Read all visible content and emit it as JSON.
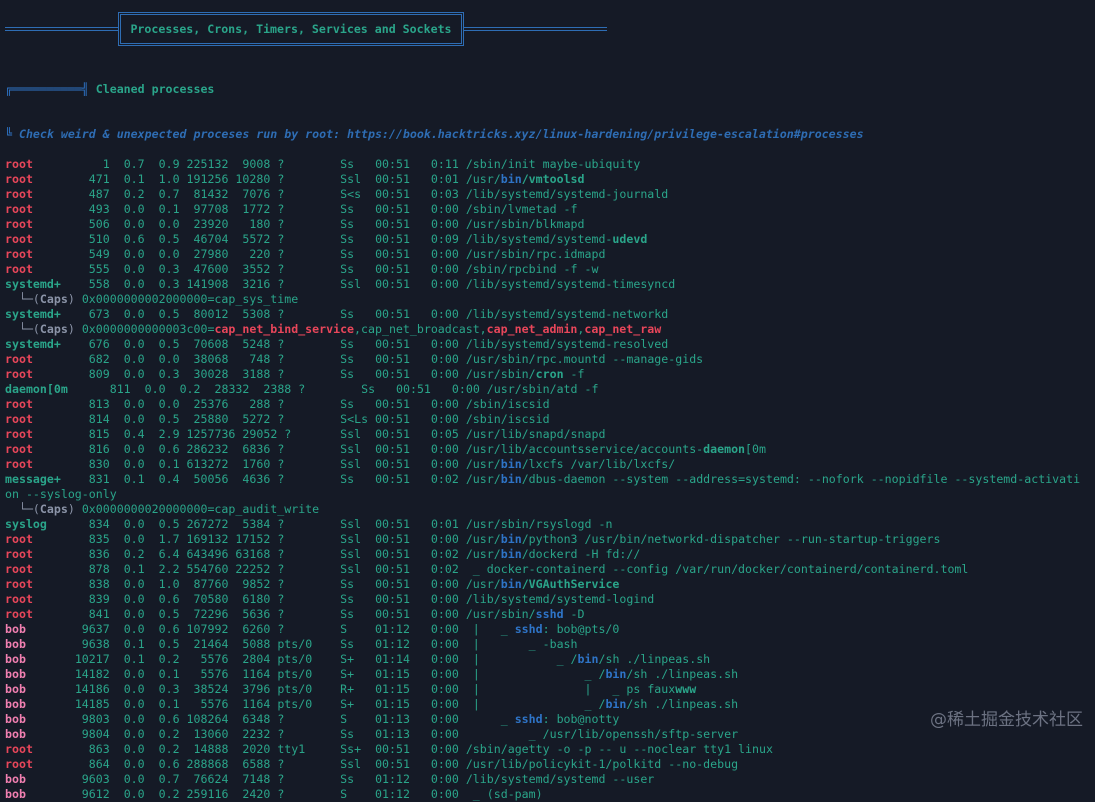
{
  "header": {
    "title": "Processes, Crons, Timers, Services and Sockets"
  },
  "section": {
    "title": "Cleaned processes",
    "hint": "Check weird & unexpected proceses run by root: https://book.hacktricks.xyz/linux-hardening/privilege-escalation#processes"
  },
  "caps_label": "Caps",
  "watermark": "@稀土掘金技术社区",
  "theme": {
    "background": "#151a26",
    "teal": "#2aa58a",
    "red": "#e8465a",
    "pink": "#f07fb0",
    "blue": "#2e74c7",
    "gray": "#8b94a8"
  },
  "lines": [
    {
      "type": "proc",
      "user": "root",
      "pid": "1",
      "cpu": "0.7",
      "mem": "0.9",
      "vsz": "225132",
      "rss": "9008",
      "tty": "?",
      "stat": "Ss",
      "start": "00:51",
      "time": "0:11",
      "cmd": [
        [
          "/sbin/init maybe-ubiquity",
          ""
        ]
      ]
    },
    {
      "type": "proc",
      "user": "root",
      "pid": "471",
      "cpu": "0.1",
      "mem": "1.0",
      "vsz": "191256",
      "rss": "10280",
      "tty": "?",
      "stat": "Ssl",
      "start": "00:51",
      "time": "0:01",
      "cmd": [
        [
          "/usr/",
          ""
        ],
        [
          "bin",
          "bb"
        ],
        [
          "/vmtoolsd",
          "g"
        ]
      ]
    },
    {
      "type": "proc",
      "user": "root",
      "pid": "487",
      "cpu": "0.2",
      "mem": "0.7",
      "vsz": "81432",
      "rss": "7076",
      "tty": "?",
      "stat": "S<s",
      "start": "00:51",
      "time": "0:03",
      "cmd": [
        [
          "/lib/systemd/systemd-journald",
          ""
        ]
      ]
    },
    {
      "type": "proc",
      "user": "root",
      "pid": "493",
      "cpu": "0.0",
      "mem": "0.1",
      "vsz": "97708",
      "rss": "1772",
      "tty": "?",
      "stat": "Ss",
      "start": "00:51",
      "time": "0:00",
      "cmd": [
        [
          "/sbin/lvmetad -f",
          ""
        ]
      ]
    },
    {
      "type": "proc",
      "user": "root",
      "pid": "506",
      "cpu": "0.0",
      "mem": "0.0",
      "vsz": "23920",
      "rss": "180",
      "tty": "?",
      "stat": "Ss",
      "start": "00:51",
      "time": "0:00",
      "cmd": [
        [
          "/usr/sbin/blkmapd",
          ""
        ]
      ]
    },
    {
      "type": "proc",
      "user": "root",
      "pid": "510",
      "cpu": "0.6",
      "mem": "0.5",
      "vsz": "46704",
      "rss": "5572",
      "tty": "?",
      "stat": "Ss",
      "start": "00:51",
      "time": "0:09",
      "cmd": [
        [
          "/lib/systemd/systemd-",
          ""
        ],
        [
          "udevd",
          "g"
        ]
      ]
    },
    {
      "type": "proc",
      "user": "root",
      "pid": "549",
      "cpu": "0.0",
      "mem": "0.0",
      "vsz": "27980",
      "rss": "220",
      "tty": "?",
      "stat": "Ss",
      "start": "00:51",
      "time": "0:00",
      "cmd": [
        [
          "/usr/sbin/rpc.idmapd",
          ""
        ]
      ]
    },
    {
      "type": "proc",
      "user": "root",
      "pid": "555",
      "cpu": "0.0",
      "mem": "0.3",
      "vsz": "47600",
      "rss": "3552",
      "tty": "?",
      "stat": "Ss",
      "start": "00:51",
      "time": "0:00",
      "cmd": [
        [
          "/sbin/rpcbind -f -w",
          ""
        ]
      ]
    },
    {
      "type": "proc",
      "user": "systemd+",
      "pid": "558",
      "cpu": "0.0",
      "mem": "0.3",
      "vsz": "141908",
      "rss": "3216",
      "tty": "?",
      "stat": "Ssl",
      "start": "00:51",
      "time": "0:00",
      "cmd": [
        [
          "/lib/systemd/systemd-timesyncd",
          ""
        ]
      ]
    },
    {
      "type": "caps",
      "value": [
        [
          "0x0000000002000000=cap_sys_time",
          ""
        ]
      ]
    },
    {
      "type": "proc",
      "user": "systemd+",
      "pid": "673",
      "cpu": "0.0",
      "mem": "0.5",
      "vsz": "80012",
      "rss": "5308",
      "tty": "?",
      "stat": "Ss",
      "start": "00:51",
      "time": "0:00",
      "cmd": [
        [
          "/lib/systemd/systemd-networkd",
          ""
        ]
      ]
    },
    {
      "type": "caps",
      "value": [
        [
          "0x0000000000003c00=",
          ""
        ],
        [
          "cap_net_bind_service",
          "r"
        ],
        [
          ",cap_net_broadcast,",
          ""
        ],
        [
          "cap_net_admin",
          "r"
        ],
        [
          ",",
          ""
        ],
        [
          "cap_net_raw",
          "r"
        ]
      ]
    },
    {
      "type": "proc",
      "user": "systemd+",
      "pid": "676",
      "cpu": "0.0",
      "mem": "0.5",
      "vsz": "70608",
      "rss": "5248",
      "tty": "?",
      "stat": "Ss",
      "start": "00:51",
      "time": "0:00",
      "cmd": [
        [
          "/lib/systemd/systemd-resolved",
          ""
        ]
      ]
    },
    {
      "type": "proc",
      "user": "root",
      "pid": "682",
      "cpu": "0.0",
      "mem": "0.0",
      "vsz": "38068",
      "rss": "748",
      "tty": "?",
      "stat": "Ss",
      "start": "00:51",
      "time": "0:00",
      "cmd": [
        [
          "/usr/sbin/rpc.mountd --manage-gids",
          ""
        ]
      ]
    },
    {
      "type": "proc",
      "user": "root",
      "pid": "809",
      "cpu": "0.0",
      "mem": "0.3",
      "vsz": "30028",
      "rss": "3188",
      "tty": "?",
      "stat": "Ss",
      "start": "00:51",
      "time": "0:00",
      "cmd": [
        [
          "/usr/sbin/",
          ""
        ],
        [
          "cron",
          "g"
        ],
        [
          " -f",
          ""
        ]
      ]
    },
    {
      "type": "proc",
      "user": "daemon[0m",
      "pid": "811",
      "cpu": "0.0",
      "mem": "0.2",
      "vsz": "28332",
      "rss": "2388",
      "tty": "?",
      "stat": "Ss",
      "start": "00:51",
      "time": "0:00",
      "cmd": [
        [
          "/usr/sbin/atd -f",
          ""
        ]
      ]
    },
    {
      "type": "proc",
      "user": "root",
      "pid": "813",
      "cpu": "0.0",
      "mem": "0.0",
      "vsz": "25376",
      "rss": "288",
      "tty": "?",
      "stat": "Ss",
      "start": "00:51",
      "time": "0:00",
      "cmd": [
        [
          "/sbin/iscsid",
          ""
        ]
      ]
    },
    {
      "type": "proc",
      "user": "root",
      "pid": "814",
      "cpu": "0.0",
      "mem": "0.5",
      "vsz": "25880",
      "rss": "5272",
      "tty": "?",
      "stat": "S<Ls",
      "start": "00:51",
      "time": "0:00",
      "cmd": [
        [
          "/sbin/iscsid",
          ""
        ]
      ]
    },
    {
      "type": "proc",
      "user": "root",
      "pid": "815",
      "cpu": "0.4",
      "mem": "2.9",
      "vsz": "1257736",
      "rss": "29052",
      "tty": "?",
      "stat": "Ssl",
      "start": "00:51",
      "time": "0:05",
      "cmd": [
        [
          "/usr/lib/snapd/snapd",
          ""
        ]
      ]
    },
    {
      "type": "proc",
      "user": "root",
      "pid": "816",
      "cpu": "0.0",
      "mem": "0.6",
      "vsz": "286232",
      "rss": "6836",
      "tty": "?",
      "stat": "Ssl",
      "start": "00:51",
      "time": "0:00",
      "cmd": [
        [
          "/usr/lib/accountsservice/accounts-",
          ""
        ],
        [
          "daemon",
          "g"
        ],
        [
          "[0m",
          ""
        ]
      ]
    },
    {
      "type": "proc",
      "user": "root",
      "pid": "830",
      "cpu": "0.0",
      "mem": "0.1",
      "vsz": "613272",
      "rss": "1760",
      "tty": "?",
      "stat": "Ssl",
      "start": "00:51",
      "time": "0:00",
      "cmd": [
        [
          "/usr/",
          ""
        ],
        [
          "bin",
          "bb"
        ],
        [
          "/lxcfs /var/lib/lxcfs/",
          ""
        ]
      ]
    },
    {
      "type": "proc",
      "user": "message+",
      "pid": "831",
      "cpu": "0.1",
      "mem": "0.4",
      "vsz": "50056",
      "rss": "4636",
      "tty": "?",
      "stat": "Ss",
      "start": "00:51",
      "time": "0:02",
      "cmd": [
        [
          "/usr/",
          ""
        ],
        [
          "bin",
          "bb"
        ],
        [
          "/dbus-daemon --system --address=systemd: --nofork --nopidfile --systemd-activation --syslog-only",
          ""
        ]
      ]
    },
    {
      "type": "caps",
      "value": [
        [
          "0x0000000020000000=cap_audit_write",
          ""
        ]
      ]
    },
    {
      "type": "proc",
      "user": "syslog",
      "pid": "834",
      "cpu": "0.0",
      "mem": "0.5",
      "vsz": "267272",
      "rss": "5384",
      "tty": "?",
      "stat": "Ssl",
      "start": "00:51",
      "time": "0:01",
      "cmd": [
        [
          "/usr/sbin/rsyslogd -n",
          ""
        ]
      ]
    },
    {
      "type": "proc",
      "user": "root",
      "pid": "835",
      "cpu": "0.0",
      "mem": "1.7",
      "vsz": "169132",
      "rss": "17152",
      "tty": "?",
      "stat": "Ssl",
      "start": "00:51",
      "time": "0:00",
      "cmd": [
        [
          "/usr/",
          ""
        ],
        [
          "bin",
          "bb"
        ],
        [
          "/python3 /usr/bin/networkd-dispatcher --run-startup-triggers",
          ""
        ]
      ]
    },
    {
      "type": "proc",
      "user": "root",
      "pid": "836",
      "cpu": "0.2",
      "mem": "6.4",
      "vsz": "643496",
      "rss": "63168",
      "tty": "?",
      "stat": "Ssl",
      "start": "00:51",
      "time": "0:02",
      "cmd": [
        [
          "/usr/",
          ""
        ],
        [
          "bin",
          "bb"
        ],
        [
          "/dockerd -H fd://",
          ""
        ]
      ]
    },
    {
      "type": "proc",
      "user": "root",
      "pid": "878",
      "cpu": "0.1",
      "mem": "2.2",
      "vsz": "554760",
      "rss": "22252",
      "tty": "?",
      "stat": "Ssl",
      "start": "00:51",
      "time": "0:02",
      "cmd": [
        [
          " _ docker-containerd --config /var/run/docker/containerd/containerd.toml",
          ""
        ]
      ]
    },
    {
      "type": "proc",
      "user": "root",
      "pid": "838",
      "cpu": "0.0",
      "mem": "1.0",
      "vsz": "87760",
      "rss": "9852",
      "tty": "?",
      "stat": "Ss",
      "start": "00:51",
      "time": "0:00",
      "cmd": [
        [
          "/usr/",
          ""
        ],
        [
          "bin",
          "bb"
        ],
        [
          "/VGAuthService",
          "g"
        ]
      ]
    },
    {
      "type": "proc",
      "user": "root",
      "pid": "839",
      "cpu": "0.0",
      "mem": "0.6",
      "vsz": "70580",
      "rss": "6180",
      "tty": "?",
      "stat": "Ss",
      "start": "00:51",
      "time": "0:00",
      "cmd": [
        [
          "/lib/systemd/systemd-logind",
          ""
        ]
      ]
    },
    {
      "type": "proc",
      "user": "root",
      "pid": "841",
      "cpu": "0.0",
      "mem": "0.5",
      "vsz": "72296",
      "rss": "5636",
      "tty": "?",
      "stat": "Ss",
      "start": "00:51",
      "time": "0:00",
      "cmd": [
        [
          "/usr/sbin/",
          ""
        ],
        [
          "sshd",
          "bb"
        ],
        [
          " -D",
          ""
        ]
      ]
    },
    {
      "type": "proc",
      "user": "bob",
      "pid": "9637",
      "cpu": "0.0",
      "mem": "0.6",
      "vsz": "107992",
      "rss": "6260",
      "tty": "?",
      "stat": "S",
      "start": "01:12",
      "time": "0:00",
      "cmd": [
        [
          " |   _ ",
          ""
        ],
        [
          "sshd",
          "bb"
        ],
        [
          ": bob@pts/0",
          ""
        ]
      ]
    },
    {
      "type": "proc",
      "user": "bob",
      "pid": "9638",
      "cpu": "0.1",
      "mem": "0.5",
      "vsz": "21464",
      "rss": "5088",
      "tty": "pts/0",
      "stat": "Ss",
      "start": "01:12",
      "time": "0:00",
      "cmd": [
        [
          " |       _ -bash",
          ""
        ]
      ]
    },
    {
      "type": "proc",
      "user": "bob",
      "pid": "10217",
      "cpu": "0.1",
      "mem": "0.2",
      "vsz": "5576",
      "rss": "2804",
      "tty": "pts/0",
      "stat": "S+",
      "start": "01:14",
      "time": "0:00",
      "cmd": [
        [
          " |           _ /",
          ""
        ],
        [
          "bin",
          "bb"
        ],
        [
          "/sh ./linpeas.sh",
          ""
        ]
      ]
    },
    {
      "type": "proc",
      "user": "bob",
      "pid": "14182",
      "cpu": "0.0",
      "mem": "0.1",
      "vsz": "5576",
      "rss": "1164",
      "tty": "pts/0",
      "stat": "S+",
      "start": "01:15",
      "time": "0:00",
      "cmd": [
        [
          " |               _ /",
          ""
        ],
        [
          "bin",
          "bb"
        ],
        [
          "/sh ./linpeas.sh",
          ""
        ]
      ]
    },
    {
      "type": "proc",
      "user": "bob",
      "pid": "14186",
      "cpu": "0.0",
      "mem": "0.3",
      "vsz": "38524",
      "rss": "3796",
      "tty": "pts/0",
      "stat": "R+",
      "start": "01:15",
      "time": "0:00",
      "cmd": [
        [
          " |               |   _ ps faux",
          ""
        ],
        [
          "www",
          "g"
        ]
      ]
    },
    {
      "type": "proc",
      "user": "bob",
      "pid": "14185",
      "cpu": "0.0",
      "mem": "0.1",
      "vsz": "5576",
      "rss": "1164",
      "tty": "pts/0",
      "stat": "S+",
      "start": "01:15",
      "time": "0:00",
      "cmd": [
        [
          " |               _ /",
          ""
        ],
        [
          "bin",
          "bb"
        ],
        [
          "/sh ./linpeas.sh",
          ""
        ]
      ]
    },
    {
      "type": "proc",
      "user": "bob",
      "pid": "9803",
      "cpu": "0.0",
      "mem": "0.6",
      "vsz": "108264",
      "rss": "6348",
      "tty": "?",
      "stat": "S",
      "start": "01:13",
      "time": "0:00",
      "cmd": [
        [
          "     _ ",
          ""
        ],
        [
          "sshd",
          "bb"
        ],
        [
          ": bob@notty",
          ""
        ]
      ]
    },
    {
      "type": "proc",
      "user": "bob",
      "pid": "9804",
      "cpu": "0.0",
      "mem": "0.2",
      "vsz": "13060",
      "rss": "2232",
      "tty": "?",
      "stat": "Ss",
      "start": "01:13",
      "time": "0:00",
      "cmd": [
        [
          "         _ /usr/lib/openssh/sftp-server",
          ""
        ]
      ]
    },
    {
      "type": "proc",
      "user": "root",
      "pid": "863",
      "cpu": "0.0",
      "mem": "0.2",
      "vsz": "14888",
      "rss": "2020",
      "tty": "tty1",
      "stat": "Ss+",
      "start": "00:51",
      "time": "0:00",
      "cmd": [
        [
          "/sbin/agetty -o -p -- u --noclear tty1 linux",
          ""
        ]
      ]
    },
    {
      "type": "proc",
      "user": "root",
      "pid": "864",
      "cpu": "0.0",
      "mem": "0.6",
      "vsz": "288868",
      "rss": "6588",
      "tty": "?",
      "stat": "Ssl",
      "start": "00:51",
      "time": "0:00",
      "cmd": [
        [
          "/usr/lib/policykit-1/polkitd --no-debug",
          ""
        ]
      ]
    },
    {
      "type": "proc",
      "user": "bob",
      "pid": "9603",
      "cpu": "0.0",
      "mem": "0.7",
      "vsz": "76624",
      "rss": "7148",
      "tty": "?",
      "stat": "Ss",
      "start": "01:12",
      "time": "0:00",
      "cmd": [
        [
          "/lib/systemd/systemd --user",
          ""
        ]
      ]
    },
    {
      "type": "proc",
      "user": "bob",
      "pid": "9612",
      "cpu": "0.0",
      "mem": "0.2",
      "vsz": "259116",
      "rss": "2420",
      "tty": "?",
      "stat": "S",
      "start": "01:12",
      "time": "0:00",
      "cmd": [
        [
          " _ (sd-pam)",
          ""
        ]
      ]
    }
  ]
}
